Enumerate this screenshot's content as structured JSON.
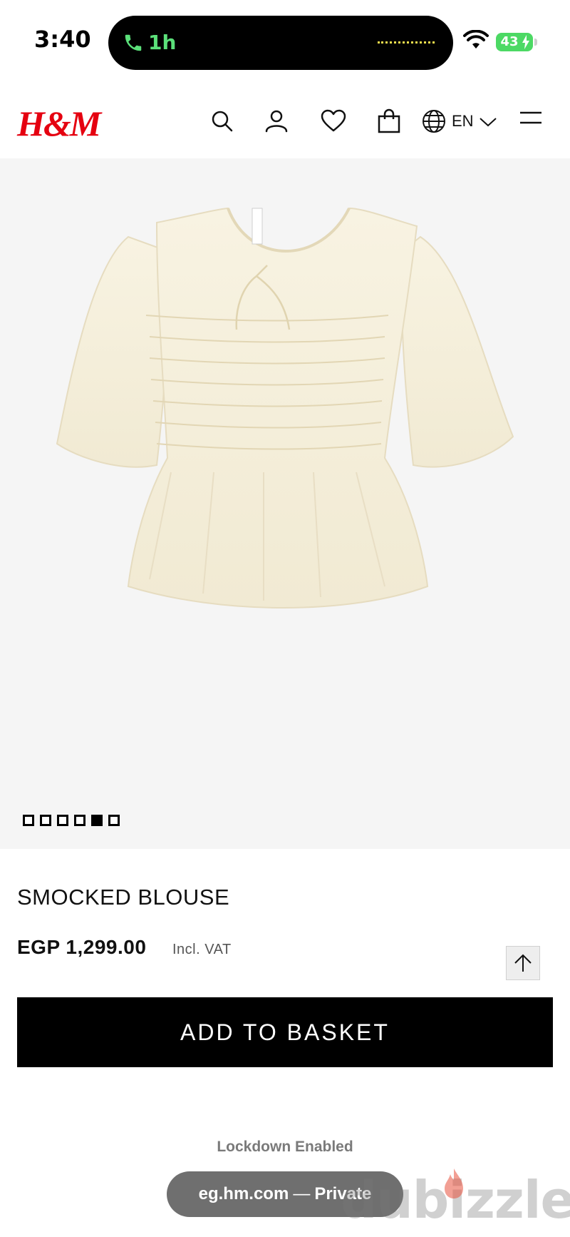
{
  "status_bar": {
    "time": "3:40",
    "call_duration": "1h",
    "battery": "43"
  },
  "header": {
    "logo": "H&M",
    "language": "EN"
  },
  "gallery": {
    "image_count": 6,
    "active_index": 4
  },
  "product": {
    "title": "SMOCKED BLOUSE",
    "price": "EGP 1,299.00",
    "vat_note": "Incl. VAT",
    "add_button": "ADD TO BASKET"
  },
  "browser": {
    "lockdown": "Lockdown Enabled",
    "url": "eg.hm.com",
    "separator": "—",
    "mode": "Private"
  },
  "watermark": "dubizzle",
  "colors": {
    "brand": "#e50010",
    "call_green": "#5be07a",
    "battery_green": "#4cd964"
  }
}
